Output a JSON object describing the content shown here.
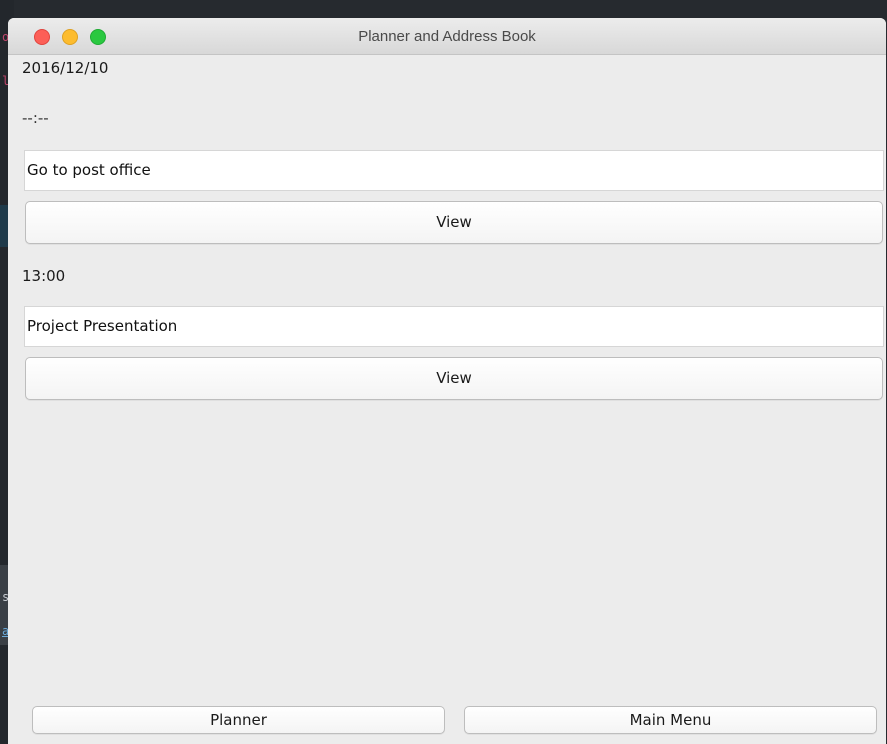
{
  "window": {
    "title": "Planner and Address Book"
  },
  "planner": {
    "date": "2016/12/10",
    "entries": [
      {
        "time": "--:--",
        "description": "Go to post office",
        "view_label": "View"
      },
      {
        "time": "13:00",
        "description": "Project Presentation",
        "view_label": "View"
      }
    ]
  },
  "footer": {
    "planner_label": "Planner",
    "main_menu_label": "Main Menu"
  },
  "background_app": {
    "fragments": [
      "o",
      "l",
      "s",
      "a"
    ]
  },
  "colors": {
    "window_bg": "#ececec",
    "close": "#fc5f57",
    "minimize": "#fdbc2e",
    "maximize": "#2ac840"
  }
}
